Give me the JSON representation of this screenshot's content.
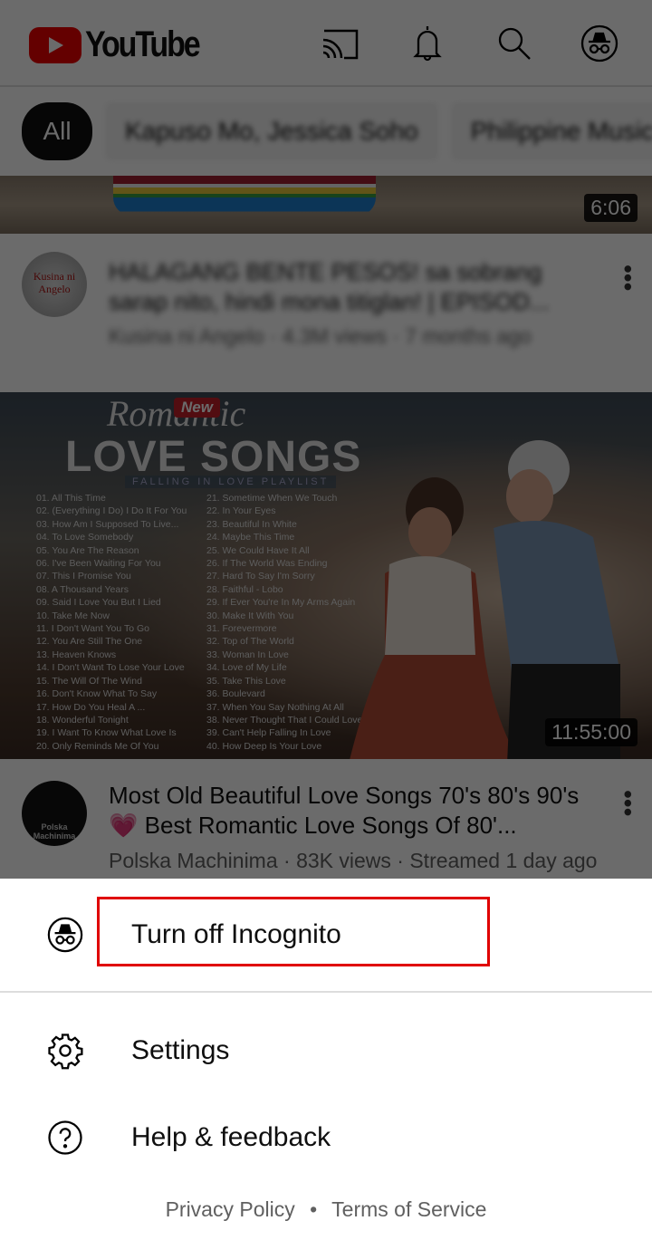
{
  "header": {
    "logo_text": "YouTube",
    "icons": [
      "cast-icon",
      "bell-icon",
      "search-icon",
      "incognito-icon"
    ]
  },
  "chips": [
    {
      "label": "All"
    },
    {
      "label": "Kapuso Mo, Jessica Soho"
    },
    {
      "label": "Philippine Music"
    }
  ],
  "videos": [
    {
      "duration": "6:06",
      "title": "HALAGANG BENTE PESOS! sa sobrang sarap nito, hindi mona titiglan! | EPISOD...",
      "meta": "Kusina ni Angelo · 4.3M views · 7 months ago",
      "channel_logo": "Kusina ni Angelo"
    },
    {
      "duration": "11:55:00",
      "title": "Most Old Beautiful Love Songs 70's 80's 90's 💗 Best Romantic Love Songs Of 80'...",
      "meta": "Polska Machinima · 83K views · Streamed 1 day ago",
      "channel_logo": "Polska Machinima",
      "thumbnail": {
        "badge": "New",
        "script": "Romantic",
        "headline": "LOVE SONGS",
        "subtitle": "FALLING IN LOVE PLAYLIST",
        "songs_left": [
          "01.  All This Time",
          "02. (Everything I Do) I Do It For You",
          "03. How Am I Supposed To Live...",
          "04. To Love Somebody",
          "05. You Are The Reason",
          "06. I've Been Waiting For You",
          "07. This I Promise You",
          "08. A Thousand Years",
          "09. Said I Love You But I Lied",
          "10.  Take Me Now",
          "11.  I Don't Want You To Go",
          "12. You Are Still The One",
          "13. Heaven Knows",
          "14. I Don't Want To Lose Your Love",
          "15. The Will Of The Wind",
          "16. Don't Know What To Say",
          "17. How Do You Heal A ...",
          "18. Wonderful Tonight",
          "19. I Want To Know What Love Is",
          "20. Only Reminds Me Of You"
        ],
        "songs_right": [
          "21. Sometime When We Touch",
          "22. In Your Eyes",
          "23. Beautiful In White",
          "24. Maybe This Time",
          "25. We Could Have It All",
          "26. If The World Was Ending",
          "27. Hard To Say I'm Sorry",
          "28. Faithful - Lobo",
          "29. If Ever You're In My Arms Again",
          "30. Make It With You",
          "31. Forevermore",
          "32. Top of The World",
          "33. Woman In Love",
          "34. Love of My Life",
          "35. Take This Love",
          "36. Boulevard",
          "37. When You Say Nothing At All",
          "38. Never Thought That I Could Love",
          "39. Can't Help Falling In Love",
          "40. How Deep Is Your Love"
        ]
      }
    }
  ],
  "menu": {
    "items": [
      {
        "label": "Turn off Incognito",
        "icon": "incognito-icon"
      },
      {
        "label": "Settings",
        "icon": "gear-icon"
      },
      {
        "label": "Help & feedback",
        "icon": "help-icon"
      }
    ],
    "footer": {
      "privacy": "Privacy Policy",
      "separator": "•",
      "terms": "Terms of Service"
    },
    "highlight_color": "#e00000"
  }
}
